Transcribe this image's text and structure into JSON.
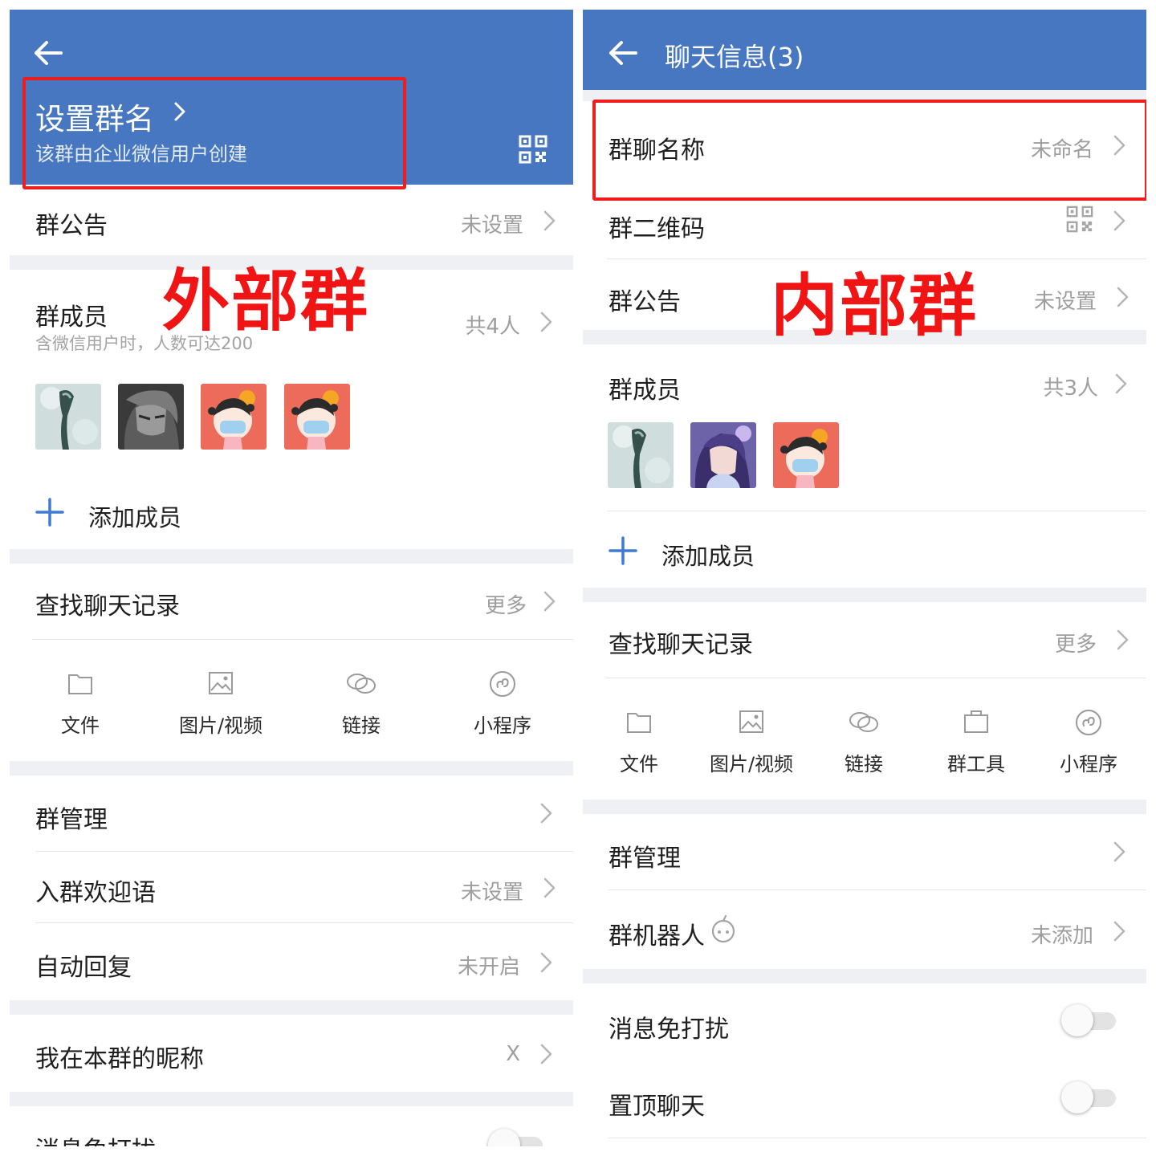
{
  "left": {
    "header": {
      "group_name": "设置群名",
      "subtitle": "该群由企业微信用户创建"
    },
    "annotation": "外部群",
    "announcement": {
      "label": "群公告",
      "value": "未设置"
    },
    "members": {
      "label": "群成员",
      "hint": "含微信用户时，人数可达200",
      "count": "共4人",
      "add_label": "添加成员"
    },
    "search": {
      "label": "查找聊天记录",
      "more": "更多"
    },
    "tools": [
      "文件",
      "图片/视频",
      "链接",
      "小程序"
    ],
    "group_manage": {
      "label": "群管理"
    },
    "welcome": {
      "label": "入群欢迎语",
      "value": "未设置"
    },
    "auto_reply": {
      "label": "自动回复",
      "value": "未开启"
    },
    "nickname": {
      "label": "我在本群的昵称",
      "value": "X"
    },
    "mute": {
      "label": "消息免打扰"
    }
  },
  "right": {
    "header": {
      "title": "聊天信息(3)"
    },
    "annotation": "内部群",
    "group_name": {
      "label": "群聊名称",
      "value": "未命名"
    },
    "qr": {
      "label": "群二维码"
    },
    "announcement": {
      "label": "群公告",
      "value": "未设置"
    },
    "members": {
      "label": "群成员",
      "count": "共3人",
      "add_label": "添加成员"
    },
    "search": {
      "label": "查找聊天记录",
      "more": "更多"
    },
    "tools": [
      "文件",
      "图片/视频",
      "链接",
      "群工具",
      "小程序"
    ],
    "group_manage": {
      "label": "群管理"
    },
    "robot": {
      "label": "群机器人",
      "value": "未添加"
    },
    "mute": {
      "label": "消息免打扰"
    },
    "pin": {
      "label": "置顶聊天"
    }
  },
  "colors": {
    "header_blue": "#4677c0",
    "accent_blue": "#3f7ad3",
    "annotation_red": "#ef1d1d",
    "section_gap": "#eef0f3"
  }
}
